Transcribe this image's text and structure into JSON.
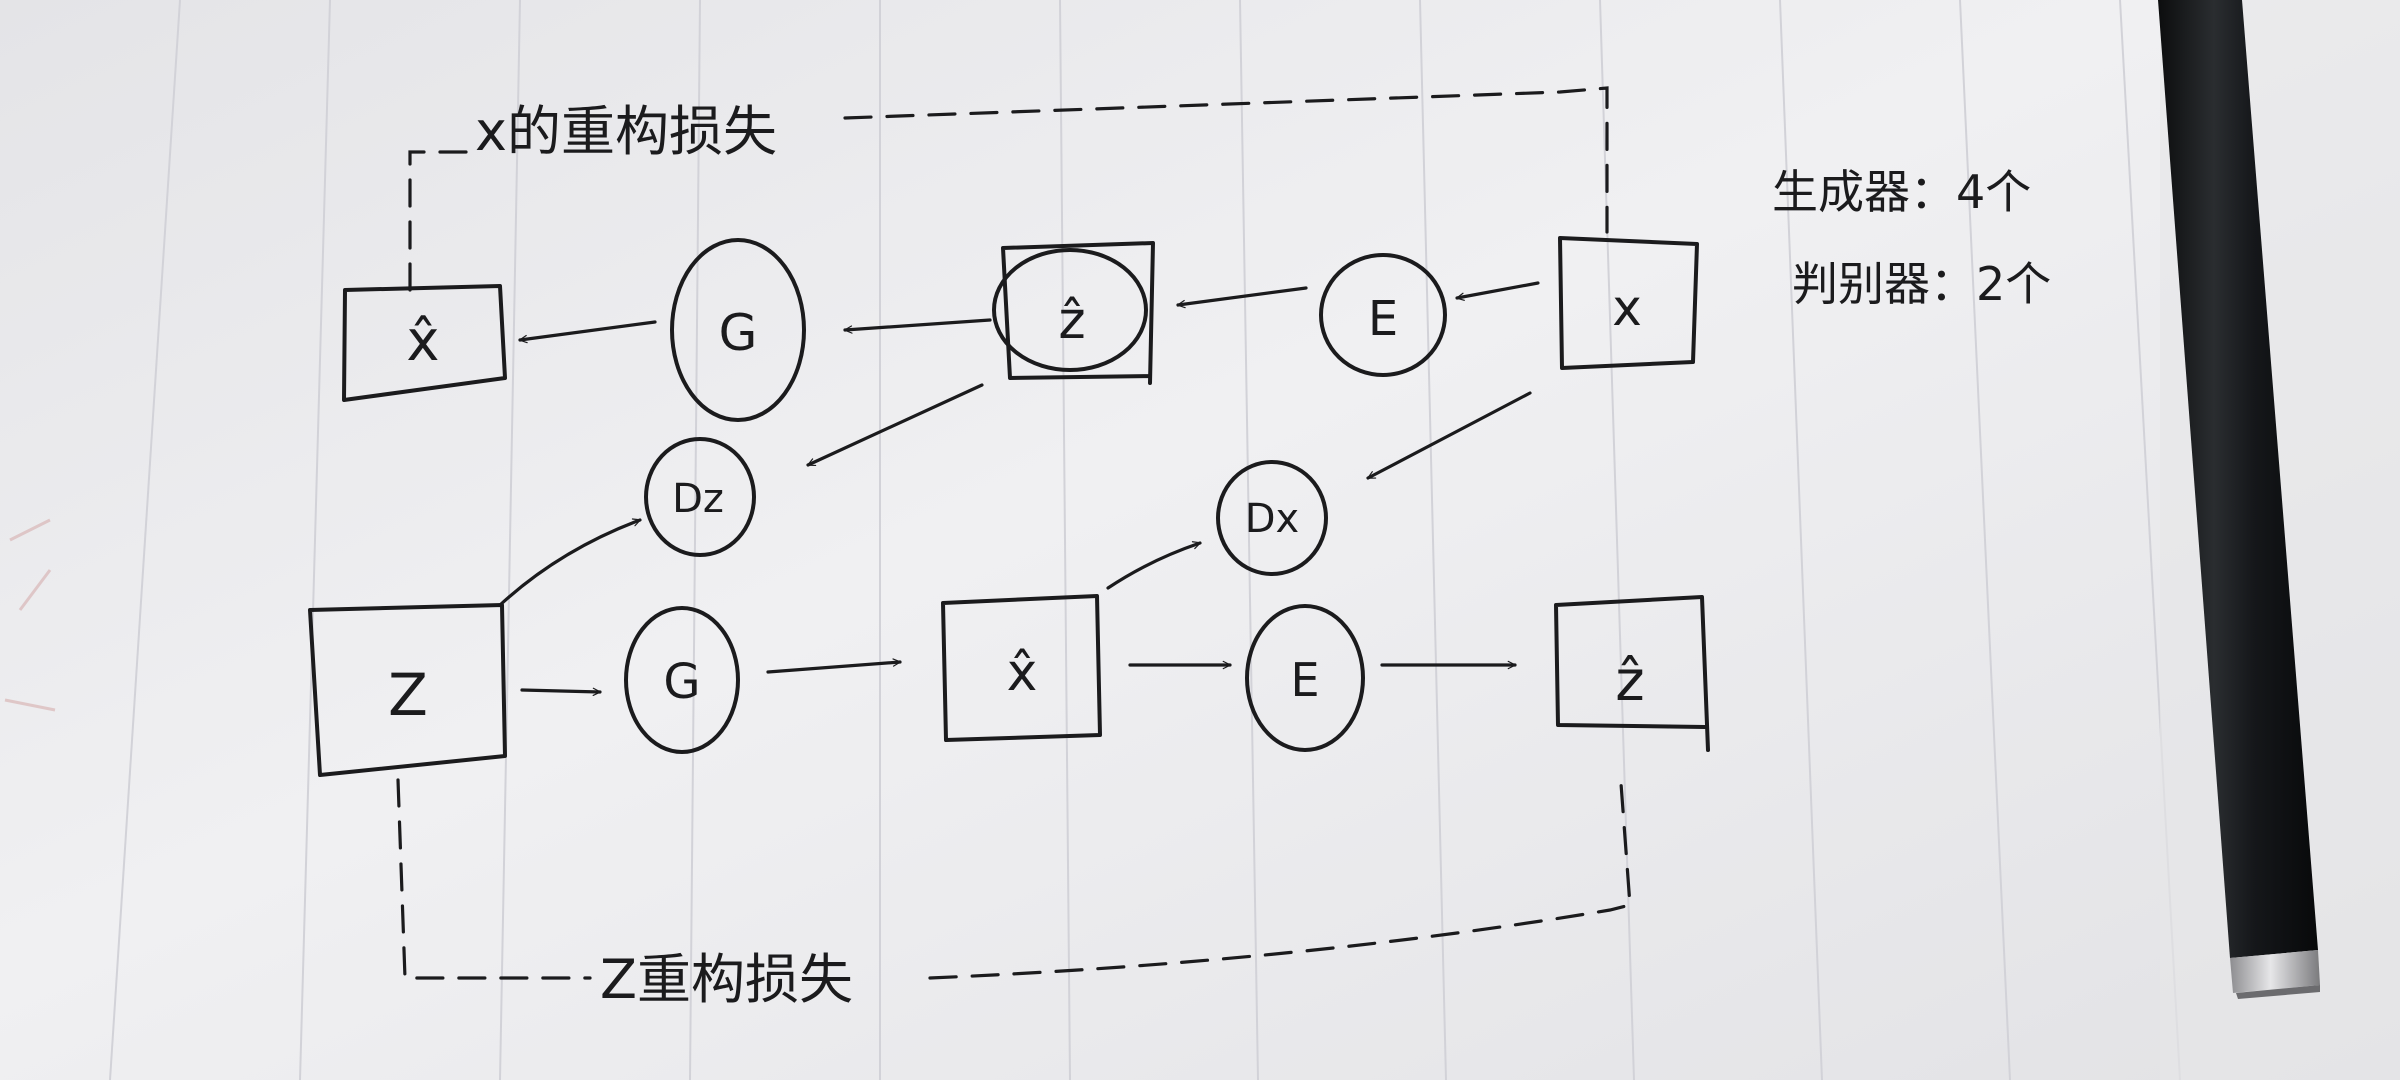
{
  "nodes": {
    "top_xhat": "x̂",
    "top_g": "G",
    "top_zhat": "ẑ",
    "top_e": "E",
    "top_x": "x",
    "dz": "Dz",
    "dx": "Dx",
    "bottom_z": "Z",
    "bottom_g": "G",
    "bottom_xhat": "x̂",
    "bottom_e": "E",
    "bottom_zhat": "ẑ"
  },
  "labels": {
    "x_recon_loss": "x的重构损失",
    "z_recon_loss": "Z重构损失"
  },
  "notes": {
    "generators": "生成器：4个",
    "discriminators": "判别器：2个"
  },
  "colors": {
    "paper": "#eeeef0",
    "ink": "#1b1b1d",
    "pen_body": "#161819",
    "pen_cap": "#c0c0c2"
  }
}
